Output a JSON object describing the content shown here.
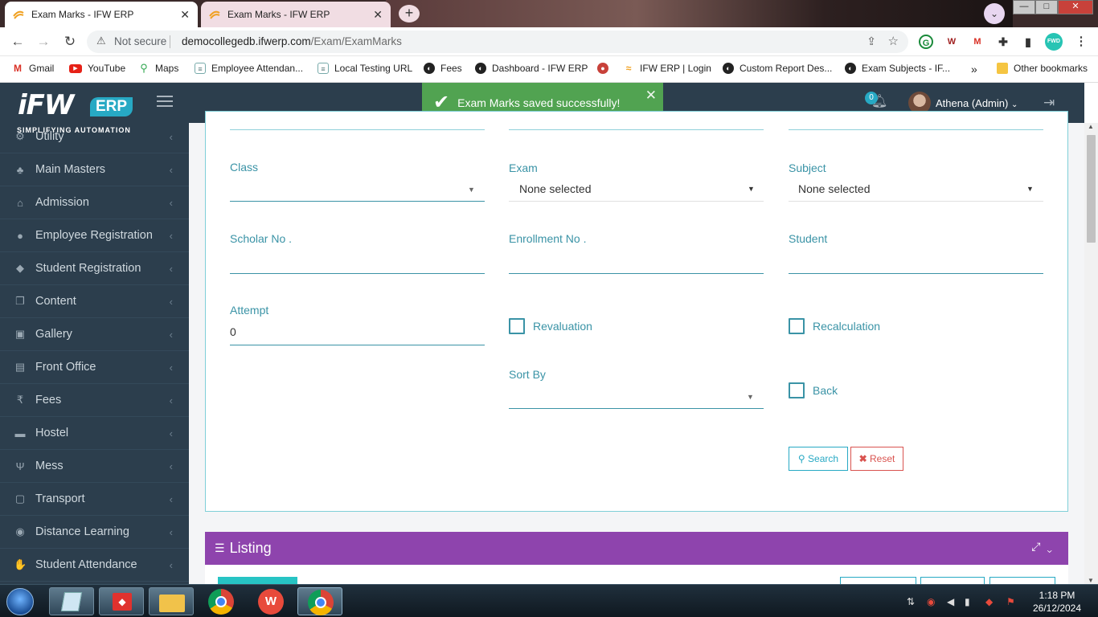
{
  "browser": {
    "tabs": [
      {
        "title": "Exam Marks - IFW ERP",
        "active": true
      },
      {
        "title": "Exam Marks - IFW ERP",
        "active": false
      }
    ],
    "new_tab": "+",
    "url_warning": "Not secure",
    "url_host": "democollegedb.ifwerp.com",
    "url_path": "/Exam/ExamMarks",
    "window_controls": {
      "minimize": "—",
      "maximize": "□",
      "close": "✕"
    }
  },
  "bookmarks": [
    {
      "label": "Gmail",
      "icon": "gmail-icon"
    },
    {
      "label": "YouTube",
      "icon": "youtube-icon"
    },
    {
      "label": "Maps",
      "icon": "maps-icon"
    },
    {
      "label": "Employee Attendan...",
      "icon": "page-icon"
    },
    {
      "label": "Local Testing URL",
      "icon": "page-icon"
    },
    {
      "label": "Fees",
      "icon": "globe-icon"
    },
    {
      "label": "Dashboard - IFW ERP",
      "icon": "globe-icon"
    },
    {
      "label": "IFW ERP | Login",
      "icon": "ifw-icon"
    },
    {
      "label": "Custom Report Des...",
      "icon": "globe-icon"
    },
    {
      "label": "Exam Subjects - IF...",
      "icon": "globe-icon"
    }
  ],
  "bookmarks_more": "»",
  "bookmarks_other": "Other bookmarks",
  "app": {
    "logo_main": "iFW",
    "logo_badge": "ERP",
    "logo_tagline": "SIMPLIFYING AUTOMATION",
    "toast": "Exam Marks saved successfully!",
    "toast_close": "✕",
    "notifications_count": "0",
    "user": "Athena (Admin)"
  },
  "sidebar": {
    "items": [
      {
        "label": "Utility",
        "icon": "gears-icon"
      },
      {
        "label": "Main Masters",
        "icon": "sitemap-icon"
      },
      {
        "label": "Admission",
        "icon": "bank-icon"
      },
      {
        "label": "Employee Registration",
        "icon": "user-icon"
      },
      {
        "label": "Student Registration",
        "icon": "graduation-cap-icon"
      },
      {
        "label": "Content",
        "icon": "copy-icon"
      },
      {
        "label": "Gallery",
        "icon": "picture-icon"
      },
      {
        "label": "Front Office",
        "icon": "building-icon"
      },
      {
        "label": "Fees",
        "icon": "rupee-icon"
      },
      {
        "label": "Hostel",
        "icon": "bed-icon"
      },
      {
        "label": "Mess",
        "icon": "cutlery-icon"
      },
      {
        "label": "Transport",
        "icon": "bus-icon"
      },
      {
        "label": "Distance Learning",
        "icon": "globe-icon"
      },
      {
        "label": "Student Attendance",
        "icon": "hand-icon"
      }
    ],
    "chevron": "‹"
  },
  "form": {
    "class_label": "Class",
    "class_value": "",
    "exam_label": "Exam",
    "exam_value": "None selected",
    "subject_label": "Subject",
    "subject_value": "None selected",
    "scholar_label": "Scholar No .",
    "enrollment_label": "Enrollment No .",
    "student_label": "Student",
    "attempt_label": "Attempt",
    "attempt_value": "0",
    "revaluation_label": "Revaluation",
    "recalculation_label": "Recalculation",
    "sortby_label": "Sort By",
    "back_label": "Back",
    "search_button": "Search",
    "reset_button": "Reset"
  },
  "listing": {
    "title": "Listing"
  },
  "taskbar": {
    "time": "1:18 PM",
    "date": "26/12/2024"
  },
  "colors": {
    "sidebar_bg": "#2c3e4d",
    "toast_bg": "#51a351",
    "accent": "#27a9c4",
    "listing_bg": "#8e44ad",
    "reset": "#d9534f"
  }
}
